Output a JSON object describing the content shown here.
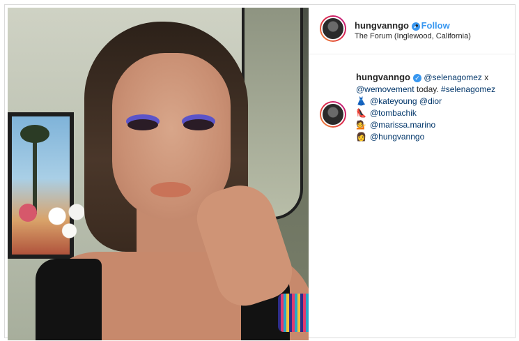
{
  "post": {
    "username": "hungvanngo",
    "verified_icon": "verified-badge-icon",
    "separator": "•",
    "follow_label": "Follow",
    "location": "The Forum (Inglewood, California)",
    "caption": {
      "username": "hungvanngo",
      "mention_1": "@selenagomez",
      "text_x": "x",
      "mention_2": "@wemovement",
      "text_today": "today.",
      "hashtag": "#selenagomez",
      "tags": [
        {
          "icon": "dress-emoji-icon",
          "glyph": "👗",
          "text_a": "@kateyoung",
          "text_b": "@dior"
        },
        {
          "icon": "high-heel-emoji-icon",
          "glyph": "👠",
          "text_a": "@tombachik",
          "text_b": ""
        },
        {
          "icon": "person-emoji-icon",
          "glyph": "💁",
          "text_a": "@marissa.marino",
          "text_b": ""
        },
        {
          "icon": "person-emoji-icon",
          "glyph": "👩",
          "text_a": "@hungvanngo",
          "text_b": ""
        }
      ]
    }
  },
  "colors": {
    "link_blue": "#3897f0",
    "mention_dark": "#003569",
    "text": "#262626"
  }
}
